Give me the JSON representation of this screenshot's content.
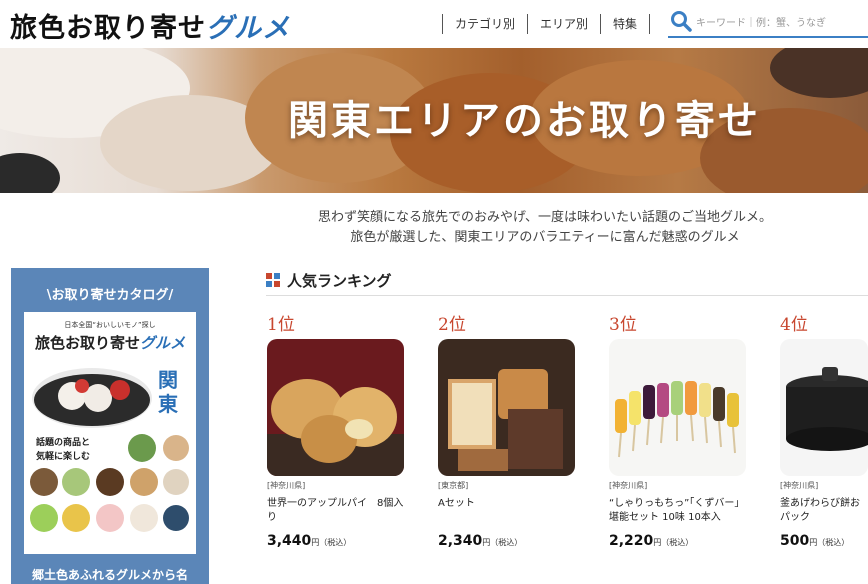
{
  "header": {
    "logo_part1": "旅色お取り寄せ",
    "logo_part2": "グルメ",
    "nav": [
      "カテゴリ別",
      "エリア別",
      "特集"
    ],
    "search_placeholder": "キーワード｜例：蟹、うなぎ",
    "icons": {
      "search": "search-icon"
    },
    "accent_color": "#3b7fc4"
  },
  "hero": {
    "title": "関東エリアのお取り寄せ"
  },
  "intro": {
    "line1": "思わず笑顔になる旅先でのおみやげ、一度は味わいたい話題のご当地グルメ。",
    "line2": "旅色が厳選した、関東エリアのバラエティーに富んだ魅惑のグルメ"
  },
  "catalog": {
    "heading": "\\お取り寄せカタログ/",
    "cover_top": "日本全国“おいしいモノ”探し",
    "cover_title1": "旅色お取り寄せ",
    "cover_title2": "グルメ",
    "cover_region": "関東",
    "cover_sub1": "話題の商品と",
    "cover_sub2": "気軽に楽しむ",
    "footer": "郷土色あふれるグルメから名"
  },
  "ranking": {
    "title": "人気ランキング",
    "items": [
      {
        "rank": "1位",
        "pref": "[神奈川県]",
        "name": "世界一のアップルパイ　8個入り",
        "price": "3,440",
        "yen": "円（税込）"
      },
      {
        "rank": "2位",
        "pref": "[東京都]",
        "name": "Aセット",
        "price": "2,340",
        "yen": "円（税込）"
      },
      {
        "rank": "3位",
        "pref": "[神奈川県]",
        "name": "“しゃりっもちっ”「くずバー」堪能セット 10味 10本入",
        "price": "2,220",
        "yen": "円（税込）"
      },
      {
        "rank": "4位",
        "pref": "[神奈川県]",
        "name": "釜あげわらび餅おパック",
        "price": "500",
        "yen": "円（税込）"
      }
    ]
  }
}
